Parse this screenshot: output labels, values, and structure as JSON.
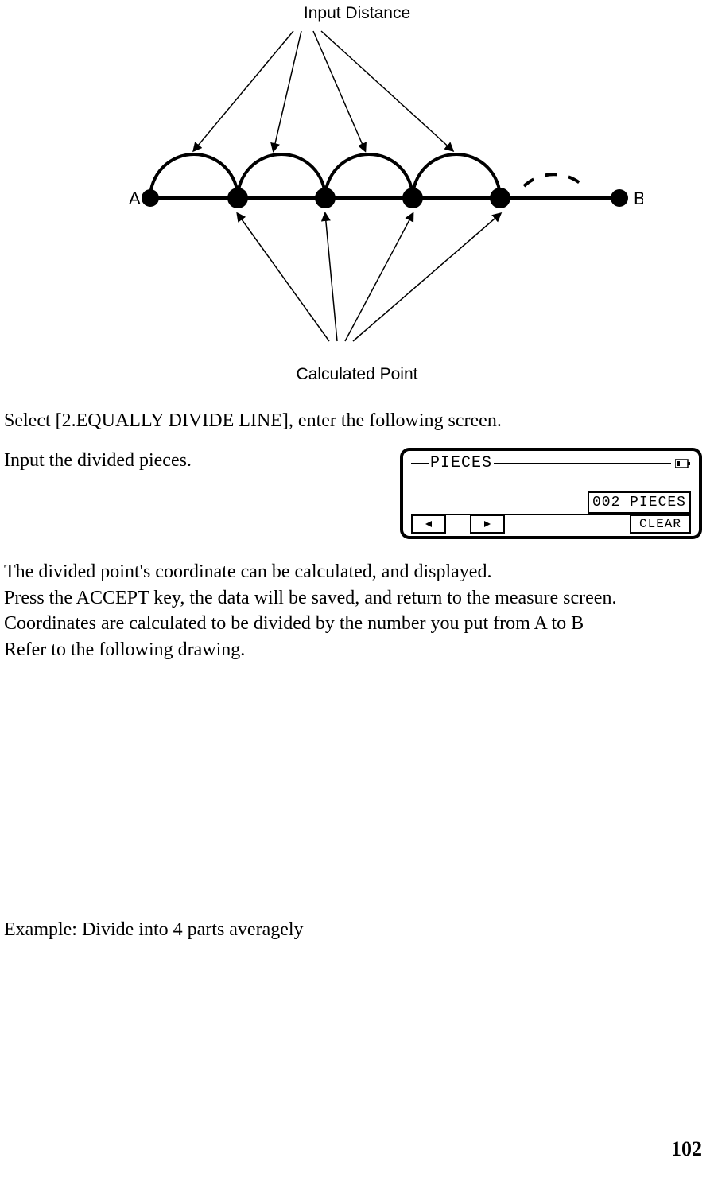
{
  "diagram": {
    "top_label": "Input Distance",
    "bottom_label": "Calculated Point",
    "point_a": "A",
    "point_b": "B"
  },
  "text": {
    "select_line": "Select [2.EQUALLY DIVIDE LINE], enter the following screen.",
    "input_pieces": "Input the divided pieces.",
    "para1": "The divided point's coordinate can be calculated, and displayed.",
    "para2": "Press the ACCEPT key, the data will be saved, and return to the measure screen.",
    "para3": "Coordinates are calculated to be divided by the number you put from A to B",
    "para4": "Refer to the following drawing.",
    "example": "Example: Divide into 4 parts averagely"
  },
  "screen": {
    "title": "PIECES",
    "value": "002 PIECES",
    "clear": "CLEAR"
  },
  "page_number": "102"
}
